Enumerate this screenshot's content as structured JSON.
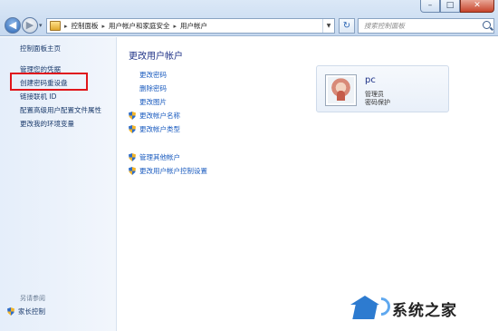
{
  "window": {
    "controls": {
      "minimize": "–",
      "maximize": "□",
      "close": "✕"
    }
  },
  "nav": {
    "back_icon": "back-arrow-icon",
    "forward_icon": "forward-arrow-icon",
    "back_glyph": "◀",
    "forward_glyph": "▶",
    "history_glyph": "▾"
  },
  "address_bar": {
    "breadcrumb": [
      "控制面板",
      "用户帐户和家庭安全",
      "用户帐户"
    ],
    "separator": "▸",
    "dropdown_glyph": "▼",
    "refresh_glyph": "↻"
  },
  "search": {
    "placeholder": "搜索控制面板"
  },
  "sidebar": {
    "items": [
      {
        "label": "控制面板主页"
      },
      {
        "label": "管理您的凭据"
      },
      {
        "label": "创建密码重设盘"
      },
      {
        "label": "链接联机 ID"
      },
      {
        "label": "配置高级用户配置文件属性"
      },
      {
        "label": "更改我的环境变量"
      }
    ],
    "see_also": "另请参阅",
    "parental_controls": "家长控制"
  },
  "main": {
    "title": "更改用户帐户",
    "links": [
      {
        "label": "更改密码",
        "shield": false
      },
      {
        "label": "删除密码",
        "shield": false
      },
      {
        "label": "更改图片",
        "shield": false
      },
      {
        "label": "更改帐户名称",
        "shield": true
      },
      {
        "label": "更改帐户类型",
        "shield": true
      },
      {
        "label": "管理其他帐户",
        "shield": true
      },
      {
        "label": "更改用户帐户控制设置",
        "shield": true
      }
    ]
  },
  "user_card": {
    "name": "pc",
    "role": "管理员",
    "status": "密码保护"
  },
  "watermark": {
    "text": "系统之家"
  },
  "colors": {
    "highlight_border": "#e0161b",
    "link": "#1a5bbf",
    "heading": "#1e3287"
  }
}
